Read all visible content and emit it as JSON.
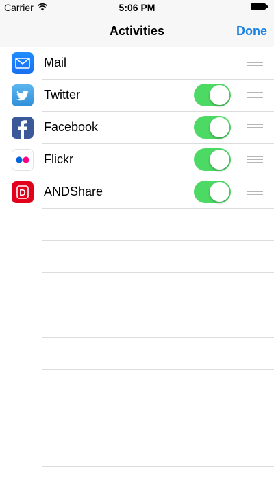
{
  "status_bar": {
    "carrier": "Carrier",
    "time": "5:06 PM"
  },
  "nav": {
    "title": "Activities",
    "done_label": "Done",
    "accent_color": "#1a82e2"
  },
  "activities": [
    {
      "label": "Mail",
      "icon": "mail-icon",
      "has_toggle": false
    },
    {
      "label": "Twitter",
      "icon": "twitter-icon",
      "has_toggle": true,
      "enabled": true
    },
    {
      "label": "Facebook",
      "icon": "facebook-icon",
      "has_toggle": true,
      "enabled": true
    },
    {
      "label": "Flickr",
      "icon": "flickr-icon",
      "has_toggle": true,
      "enabled": true
    },
    {
      "label": "ANDShare",
      "icon": "andshare-icon",
      "has_toggle": true,
      "enabled": true
    }
  ],
  "toggle_on_color": "#4cd964",
  "andshare_icon_letter": "D"
}
